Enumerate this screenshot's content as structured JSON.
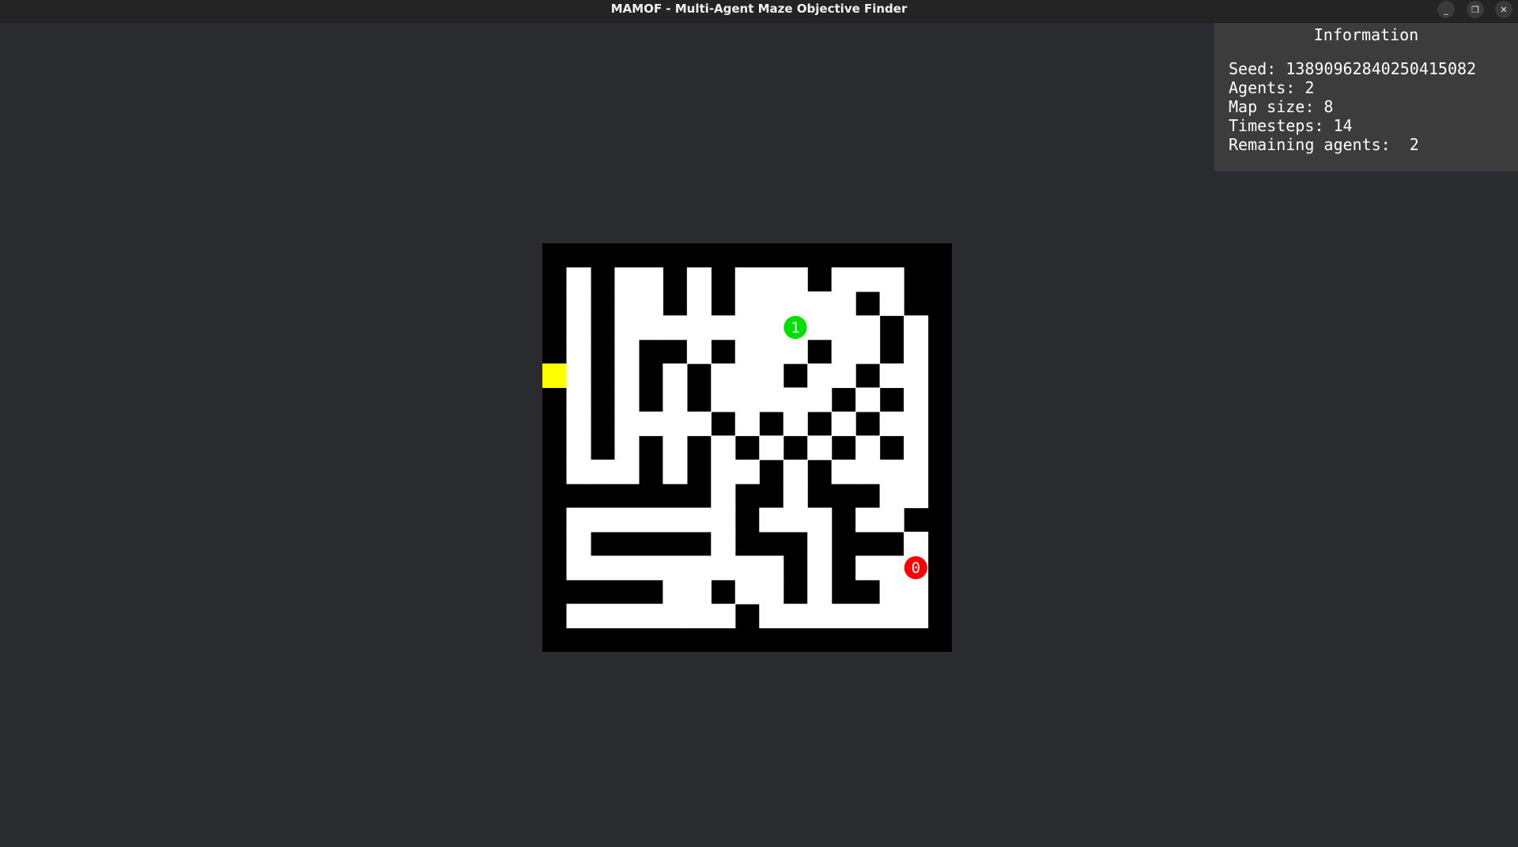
{
  "window": {
    "title": "MAMOF - Multi-Agent Maze Objective Finder",
    "buttons": [
      "minimize-icon",
      "maximize-icon",
      "close-icon"
    ]
  },
  "info": {
    "title": "Information",
    "seed": "Seed: 13890962840250415082",
    "agents": "Agents: 2",
    "map_size": "Map size: 8",
    "timesteps": "Timesteps: 14",
    "remaining_agents": "Remaining agents:  2"
  },
  "maze": {
    "columns": 17,
    "rows": 17,
    "grid": [
      "#################",
      "#.#..#.#...#...##",
      "#.#..#.#.....#.##",
      "#.#...........#.#",
      "#.#.##.#...#..#.#",
      "Y.#.#.#...#..#..#",
      "#.#.#.#.....#.#.#",
      "#.#....#.#.#.#..#",
      "#.#.#.#.#.#.#.#.#",
      "#...#.#..#.#....#",
      "#######.##.###..#",
      "#.......#...#..##",
      "#.#####.###.###.#",
      "#.........#.#...#",
      "#####..#..#.##..#",
      "#.......#.......#",
      "#################"
    ],
    "colors": {
      "wall": "#000000",
      "floor": "#ffffff",
      "goal": "#ffff00"
    },
    "agents": [
      {
        "label": "1",
        "color": "#00e000",
        "col": 10,
        "row": 3
      },
      {
        "label": "0",
        "color": "#ff0000",
        "col": 15,
        "row": 13
      }
    ]
  }
}
